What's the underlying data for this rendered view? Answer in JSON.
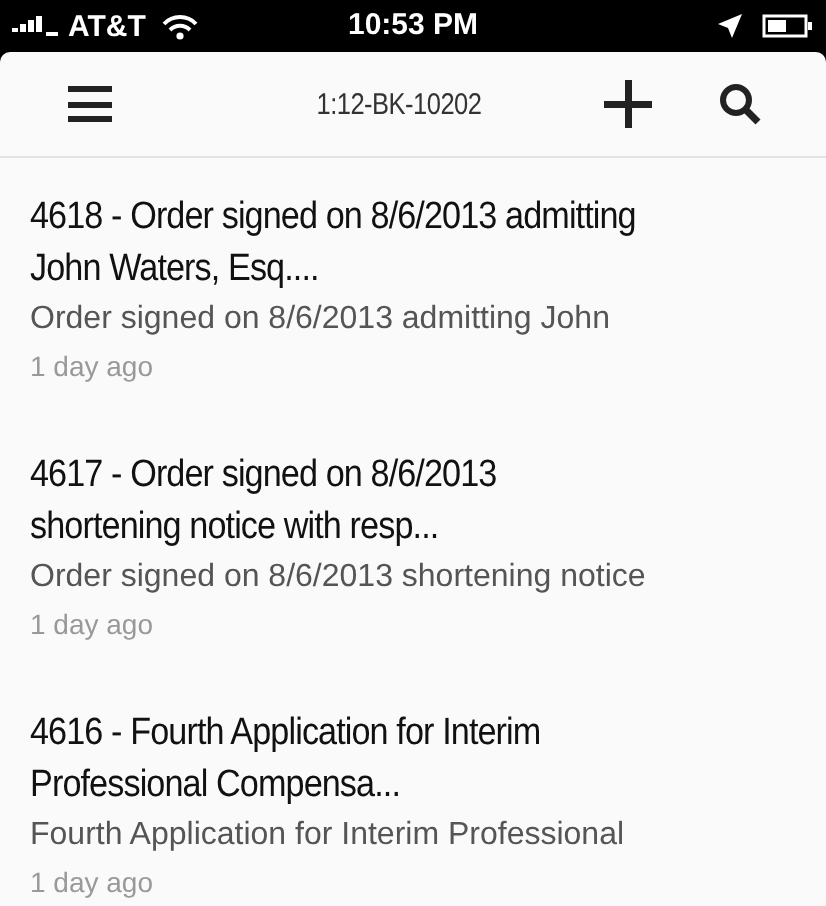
{
  "status_bar": {
    "carrier": "AT&T",
    "time": "10:53 PM"
  },
  "nav_bar": {
    "title": "1:12-BK-10202"
  },
  "items": [
    {
      "title_lines": [
        "4618 - Order signed on 8/6/2013 admitting",
        "John Waters, Esq...."
      ],
      "summary": "Order signed on 8/6/2013 admitting John",
      "time": "1 day ago"
    },
    {
      "title_lines": [
        "4617 - Order signed on 8/6/2013",
        "shortening notice with resp..."
      ],
      "summary": "Order signed on 8/6/2013 shortening notice",
      "time": "1 day ago"
    },
    {
      "title_lines": [
        "4616 - Fourth Application for Interim",
        "Professional Compensa..."
      ],
      "summary": "Fourth Application for Interim Professional",
      "time": "1 day ago"
    }
  ]
}
